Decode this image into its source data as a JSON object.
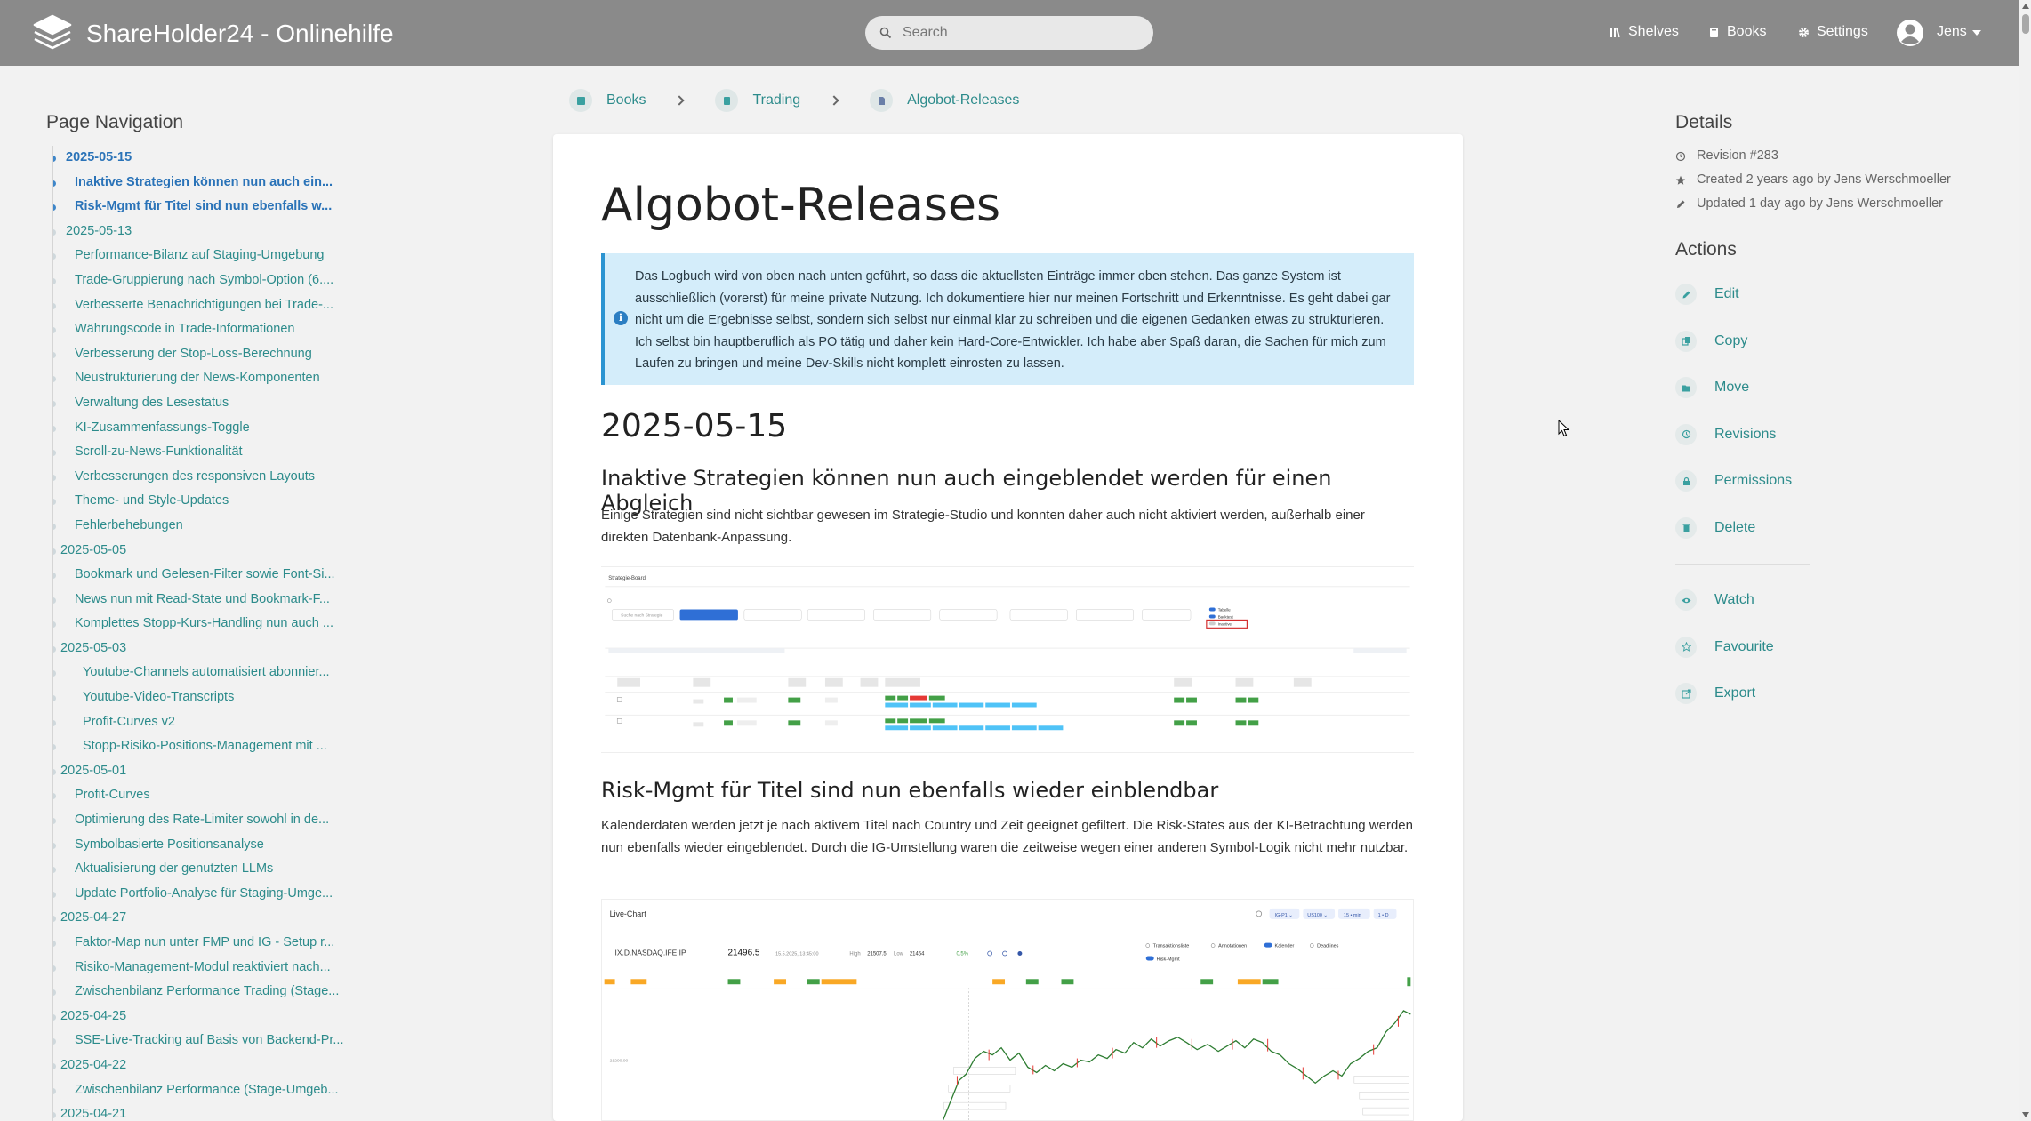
{
  "header": {
    "title": "ShareHolder24 - Onlinehilfe",
    "search_placeholder": "Search",
    "shelves": "Shelves",
    "books": "Books",
    "settings": "Settings",
    "user": "Jens"
  },
  "breadcrumb": [
    "Books",
    "Trading",
    "Algobot-Releases"
  ],
  "left_nav": {
    "title": "Page Navigation",
    "items": [
      {
        "label": "2025-05-15",
        "level": "h2",
        "active": true
      },
      {
        "label": "Inaktive Strategien können nun auch ein...",
        "level": "h3",
        "active": true
      },
      {
        "label": "Risk-Mgmt für Titel sind nun ebenfalls w...",
        "level": "h3",
        "active": true
      },
      {
        "label": "2025-05-13",
        "level": "h2",
        "active": false
      },
      {
        "label": "Performance-Bilanz auf Staging-Umgebung",
        "level": "h3",
        "active": false
      },
      {
        "label": "Trade-Gruppierung nach Symbol-Option (6....",
        "level": "h3",
        "active": false
      },
      {
        "label": "Verbesserte Benachrichtigungen bei Trade-...",
        "level": "h3",
        "active": false
      },
      {
        "label": "Währungscode in Trade-Informationen",
        "level": "h3",
        "active": false
      },
      {
        "label": "Verbesserung der Stop-Loss-Berechnung",
        "level": "h3",
        "active": false
      },
      {
        "label": "Neustrukturierung der News-Komponenten",
        "level": "h3",
        "active": false
      },
      {
        "label": "Verwaltung des Lesestatus",
        "level": "h3",
        "active": false
      },
      {
        "label": "KI-Zusammenfassungs-Toggle",
        "level": "h3",
        "active": false
      },
      {
        "label": "Scroll-zu-News-Funktionalität",
        "level": "h3",
        "active": false
      },
      {
        "label": "Verbesserungen des responsiven Layouts",
        "level": "h3",
        "active": false
      },
      {
        "label": "Theme- und Style-Updates",
        "level": "h3",
        "active": false
      },
      {
        "label": "Fehlerbehebungen",
        "level": "h3",
        "active": false
      },
      {
        "label": "2025-05-05",
        "level": "h2b",
        "active": false
      },
      {
        "label": "Bookmark und Gelesen-Filter sowie Font-Si...",
        "level": "h3",
        "active": false
      },
      {
        "label": "News nun mit Read-State und Bookmark-F...",
        "level": "h3",
        "active": false
      },
      {
        "label": "Komplettes Stopp-Kurs-Handling nun auch ...",
        "level": "h3",
        "active": false
      },
      {
        "label": "2025-05-03",
        "level": "h2b",
        "active": false
      },
      {
        "label": "Youtube-Channels automatisiert abonnier...",
        "level": "h4",
        "active": false
      },
      {
        "label": "Youtube-Video-Transcripts",
        "level": "h4",
        "active": false
      },
      {
        "label": "Profit-Curves v2",
        "level": "h4",
        "active": false
      },
      {
        "label": "Stopp-Risiko-Positions-Management mit ...",
        "level": "h4",
        "active": false
      },
      {
        "label": "2025-05-01",
        "level": "h2b",
        "active": false
      },
      {
        "label": "Profit-Curves",
        "level": "h3",
        "active": false
      },
      {
        "label": "Optimierung des Rate-Limiter sowohl in de...",
        "level": "h3",
        "active": false
      },
      {
        "label": "Symbolbasierte Positionsanalyse",
        "level": "h3",
        "active": false
      },
      {
        "label": "Aktualisierung der genutzten LLMs",
        "level": "h3",
        "active": false
      },
      {
        "label": "Update Portfolio-Analyse für Staging-Umge...",
        "level": "h3",
        "active": false
      },
      {
        "label": "2025-04-27",
        "level": "h2b",
        "active": false
      },
      {
        "label": "Faktor-Map nun unter FMP und IG - Setup r...",
        "level": "h3",
        "active": false
      },
      {
        "label": "Risiko-Management-Modul reaktiviert nach...",
        "level": "h3",
        "active": false
      },
      {
        "label": "Zwischenbilanz Performance Trading (Stage...",
        "level": "h3",
        "active": false
      },
      {
        "label": "2025-04-25",
        "level": "h2b",
        "active": false
      },
      {
        "label": "SSE-Live-Tracking auf Basis von Backend-Pr...",
        "level": "h3",
        "active": false
      },
      {
        "label": "2025-04-22",
        "level": "h2b",
        "active": false
      },
      {
        "label": "Zwischenbilanz Performance (Stage-Umgeb...",
        "level": "h3",
        "active": false
      },
      {
        "label": "2025-04-21",
        "level": "h2b",
        "active": false
      }
    ]
  },
  "page": {
    "title": "Algobot-Releases",
    "callout": "Das Logbuch wird von oben nach unten geführt, so dass die aktuellsten Einträge immer oben stehen. Das ganze System ist ausschließlich (vorerst) für meine private Nutzung. Ich dokumentiere hier nur meinen Fortschritt und Erkenntnisse. Es geht dabei gar nicht um die Ergebnisse selbst, sondern sich selbst nur einmal klar zu schreiben und die eigenen Gedanken etwas zu strukturieren. Ich selbst bin hauptberuflich als PO tätig und daher kein Hard-Core-Entwickler. Ich habe aber Spaß daran, die Sachen für mich zum Laufen zu bringen und meine Dev-Skills nicht komplett einrosten zu lassen.",
    "section_date": "2025-05-15",
    "h3_a": "Inaktive Strategien können nun auch eingeblendet werden für einen Abgleich",
    "p_a": "Einige Strategien sind nicht sichtbar gewesen im Strategie-Studio und konnten daher auch nicht aktiviert werden, außerhalb einer direkten Datenbank-Anpassung.",
    "h3_b": "Risk-Mgmt für Titel sind nun ebenfalls wieder einblendbar",
    "p_b": "Kalenderdaten werden jetzt je nach aktivem Titel nach Country und Zeit geeignet gefiltert. Die Risk-States aus der KI-Betrachtung werden nun ebenfalls wieder eingeblendet. Durch die IG-Umstellung waren die zeitweise wegen einer anderen Symbol-Logik nicht mehr nutzbar.",
    "shot1": {
      "title": "Strategie-Board",
      "search": "Suche nach Strategie",
      "toggles": [
        "Tabelle",
        "Backtest",
        "Inaktive"
      ]
    },
    "shot2": {
      "title": "Live-Chart",
      "symbol": "IX.D.NASDAQ.IFE.IP",
      "price": "21496.5",
      "date": "15.5.2025, 13:45:00",
      "high_label": "High",
      "high": "21507.5",
      "low_label": "Low",
      "low": "21464",
      "change": "0.5%",
      "chips": [
        "IG-P1 ⌄",
        "US100 ⌄",
        "15 • min",
        "1 • D"
      ],
      "legend": [
        "Transaktionsliste",
        "Annotationen",
        "Kalender",
        "Deadlines",
        "Risk-Mgmt"
      ],
      "y_tick": "21200.00"
    }
  },
  "details": {
    "title": "Details",
    "revision": "Revision #283",
    "created": "Created 2 years ago by Jens Werschmoeller",
    "updated": "Updated 1 day ago by Jens Werschmoeller"
  },
  "actions": {
    "title": "Actions",
    "items": [
      "Edit",
      "Copy",
      "Move",
      "Revisions",
      "Permissions",
      "Delete"
    ],
    "items2": [
      "Watch",
      "Favourite",
      "Export"
    ]
  }
}
